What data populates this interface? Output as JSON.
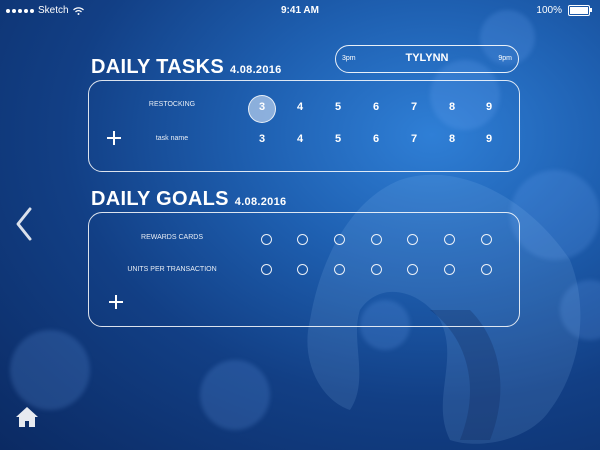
{
  "status_bar": {
    "carrier": "Sketch",
    "time": "9:41 AM",
    "battery": "100%",
    "signal_dots": 5
  },
  "shift": {
    "start": "3pm",
    "name": "TYLYNN",
    "end": "9pm"
  },
  "daily_tasks": {
    "title": "DAILY TASKS",
    "date": "4.08.2016",
    "days": [
      "3",
      "4",
      "5",
      "6",
      "7",
      "8",
      "9"
    ],
    "rows": [
      {
        "label": "RESTOCKING",
        "selected_index": 0
      },
      {
        "label": "task name",
        "selected_index": -1
      }
    ]
  },
  "daily_goals": {
    "title": "DAILY GOALS",
    "date": "4.08.2016",
    "rows": [
      {
        "label": "REWARDS CARDS"
      },
      {
        "label": "UNITS PER TRANSACTION"
      }
    ],
    "columns": 7
  },
  "icons": {
    "back": "chevron-left-icon",
    "home": "home-icon",
    "add": "plus-icon",
    "wifi": "wifi-icon",
    "battery": "battery-icon"
  }
}
